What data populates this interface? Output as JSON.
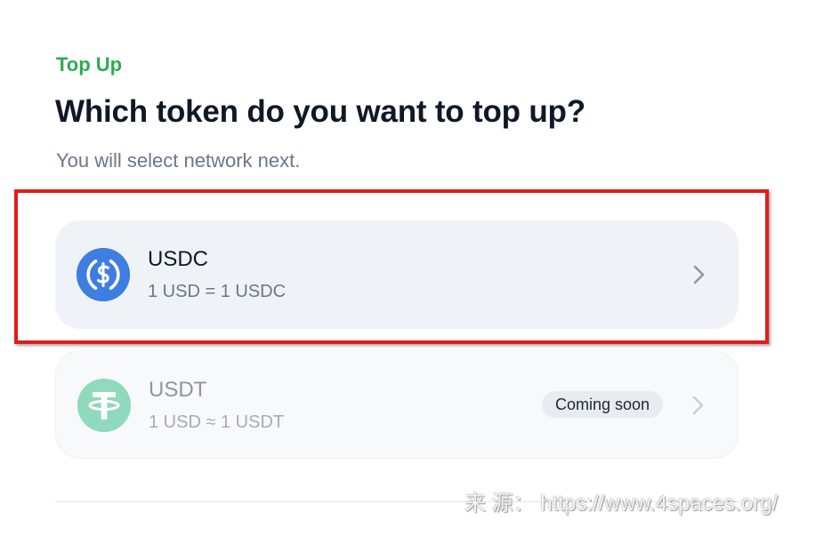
{
  "header": {
    "eyebrow": "Top Up",
    "title": "Which token do you want to top up?",
    "subtitle": "You will select network next."
  },
  "tokens": [
    {
      "name": "USDC",
      "rate": "1 USD = 1 USDC",
      "icon": "usdc-icon",
      "selected": true,
      "color": "#3e7ee0"
    },
    {
      "name": "USDT",
      "rate": "1 USD ≈ 1 USDT",
      "icon": "usdt-icon",
      "badge": "Coming soon",
      "disabled": true,
      "color": "#8fd9bd"
    }
  ],
  "watermark": "来 源： https://www.4spaces.org/",
  "colors": {
    "accent": "#2eaa52",
    "highlight": "#e31b1b",
    "usdc": "#3e7ee0",
    "usdt": "#8fd9bd"
  }
}
